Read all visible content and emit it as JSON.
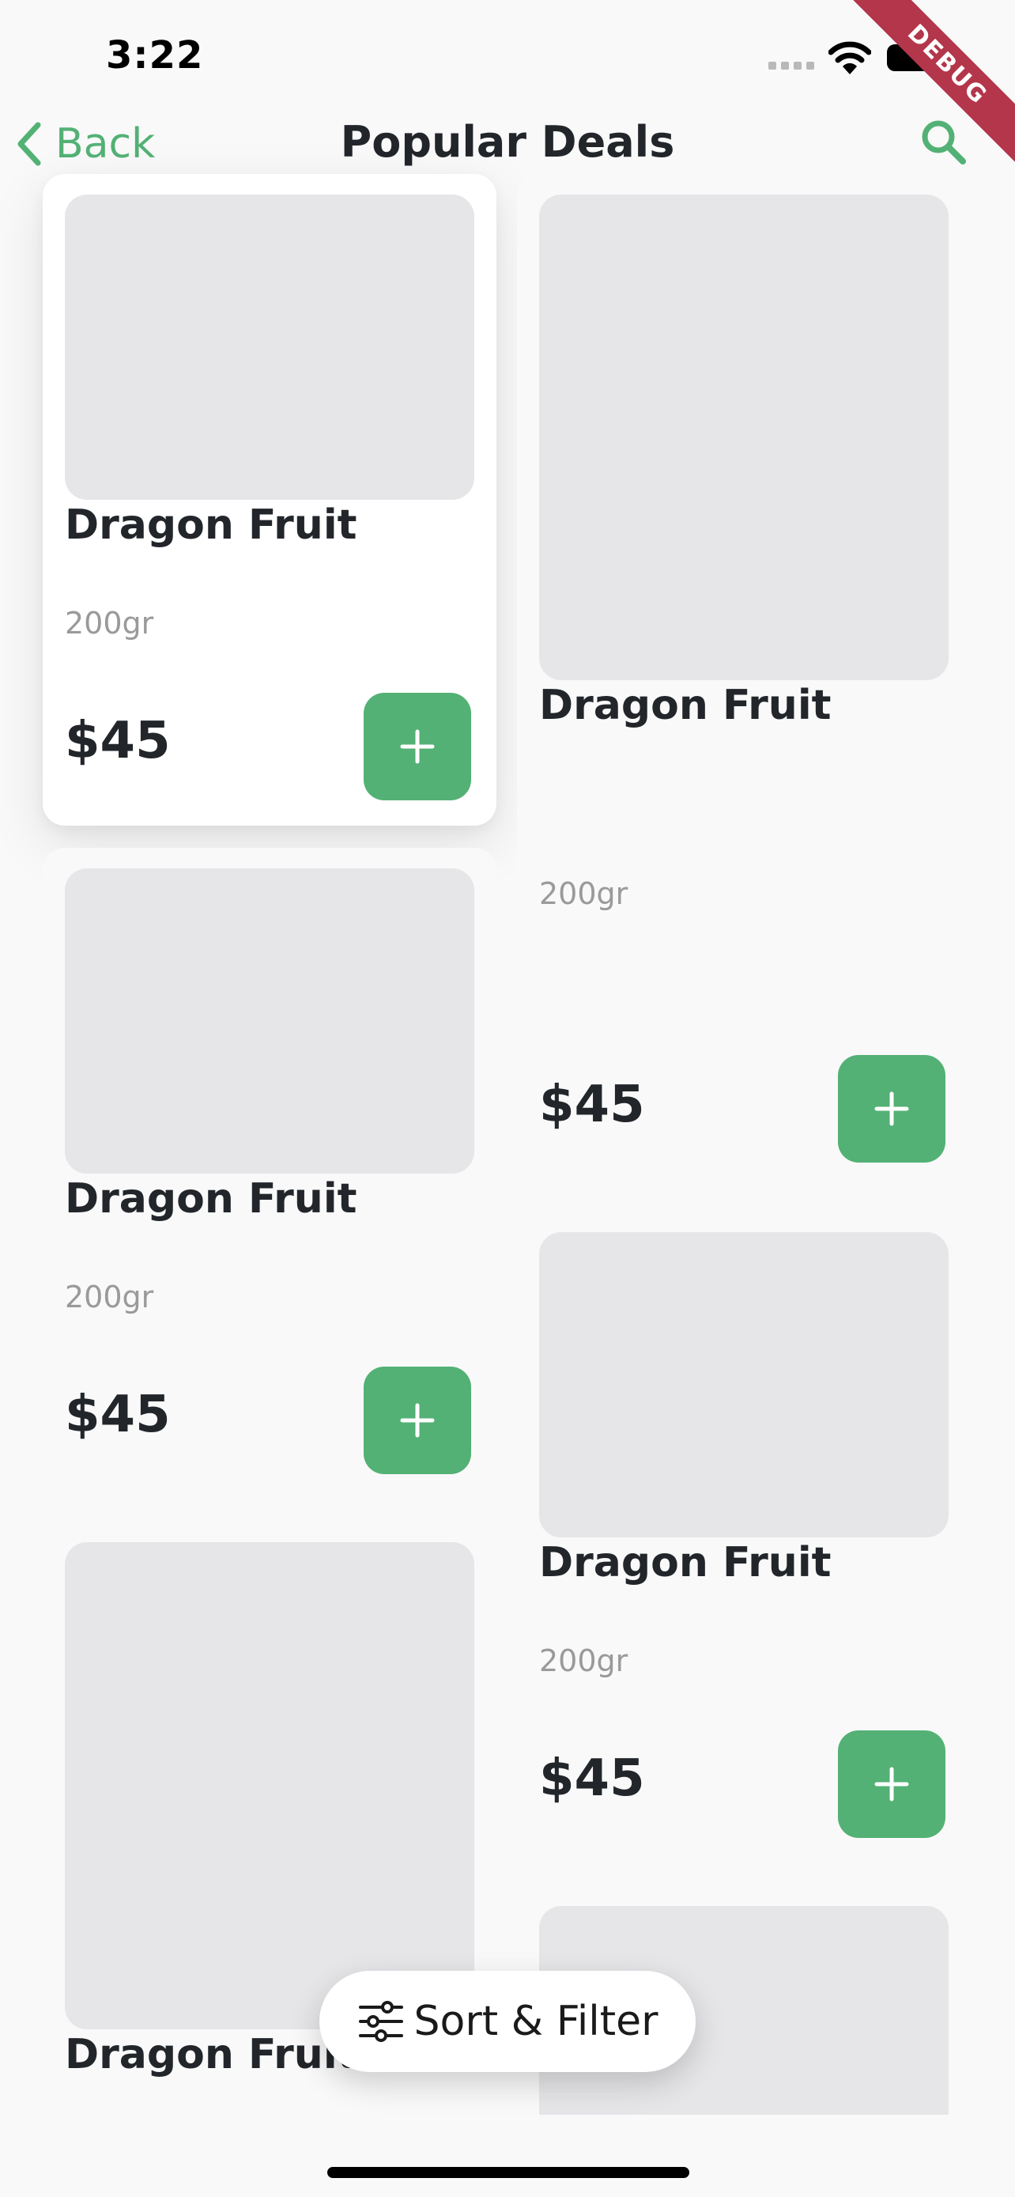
{
  "status_bar": {
    "time": "3:22"
  },
  "debug_ribbon": "DEBUG",
  "nav": {
    "back_label": "Back",
    "title": "Popular Deals",
    "search_icon": "search-icon"
  },
  "colors": {
    "accent": "#53b175",
    "placeholder": "#e6e5e8",
    "text": "#22262b",
    "muted": "#9a9a9a",
    "background": "#f9f9f9"
  },
  "products": {
    "left": [
      {
        "name": "Dragon Fruit",
        "weight": "200gr",
        "price": "$45"
      },
      {
        "name": "Dragon Fruit",
        "weight": "200gr",
        "price": "$45"
      },
      {
        "name": "Dragon Fruit"
      }
    ],
    "right": [
      {
        "name": "Dragon Fruit",
        "weight": "200gr",
        "price": "$45"
      },
      {
        "name": "Dragon Fruit",
        "weight": "200gr",
        "price": "$45"
      }
    ]
  },
  "sort_filter": {
    "label": "Sort & Filter",
    "icon": "sliders-icon"
  }
}
